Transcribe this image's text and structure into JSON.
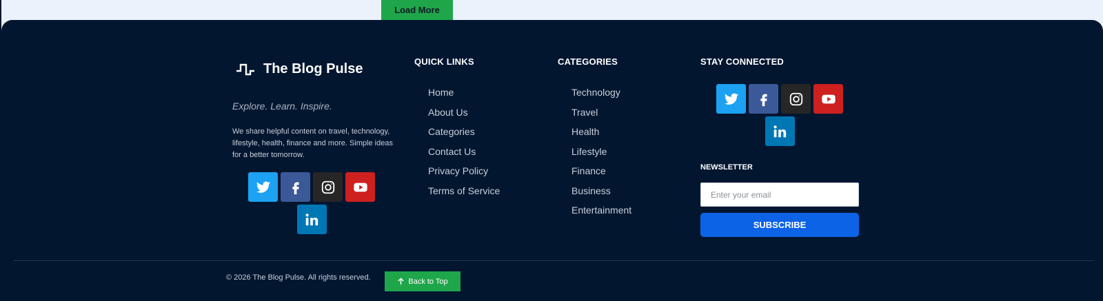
{
  "top": {
    "load_more_label": "Load More"
  },
  "brand": {
    "name": "The Blog Pulse",
    "icon": "pulse-icon"
  },
  "about": {
    "tagline": "Explore. Learn. Inspire.",
    "description": "We share helpful content on travel, technology, lifestyle, health, finance and more. Simple ideas for a better tomorrow."
  },
  "social_icons": [
    "twitter-icon",
    "facebook-icon",
    "instagram-icon",
    "youtube-icon",
    "linkedin-icon"
  ],
  "quick_links": {
    "title": "QUICK LINKS",
    "items": [
      "Home",
      "About Us",
      "Categories",
      "Contact Us",
      "Privacy Policy",
      "Terms of Service"
    ]
  },
  "categories": {
    "title": "CATEGORIES",
    "items": [
      "Technology",
      "Travel",
      "Health",
      "Lifestyle",
      "Finance",
      "Business",
      "Entertainment"
    ]
  },
  "stay_connected": {
    "title": "STAY CONNECTED"
  },
  "newsletter": {
    "title": "NEWSLETTER",
    "email_placeholder": "Enter your email",
    "email_value": "",
    "subscribe_label": "SUBSCRIBE"
  },
  "bottom": {
    "copyright": "© 2026 The Blog Pulse. All rights reserved.",
    "back_to_top_label": "Back to Top"
  },
  "colors": {
    "footer_bg": "#031630",
    "page_bg": "#ebf2fb",
    "green": "#1fa64a",
    "blue": "#0d63e6",
    "twitter": "#1da1f2",
    "facebook": "#3b5998",
    "instagram": "#262626",
    "youtube": "#cd201f",
    "linkedin": "#0077b5"
  }
}
